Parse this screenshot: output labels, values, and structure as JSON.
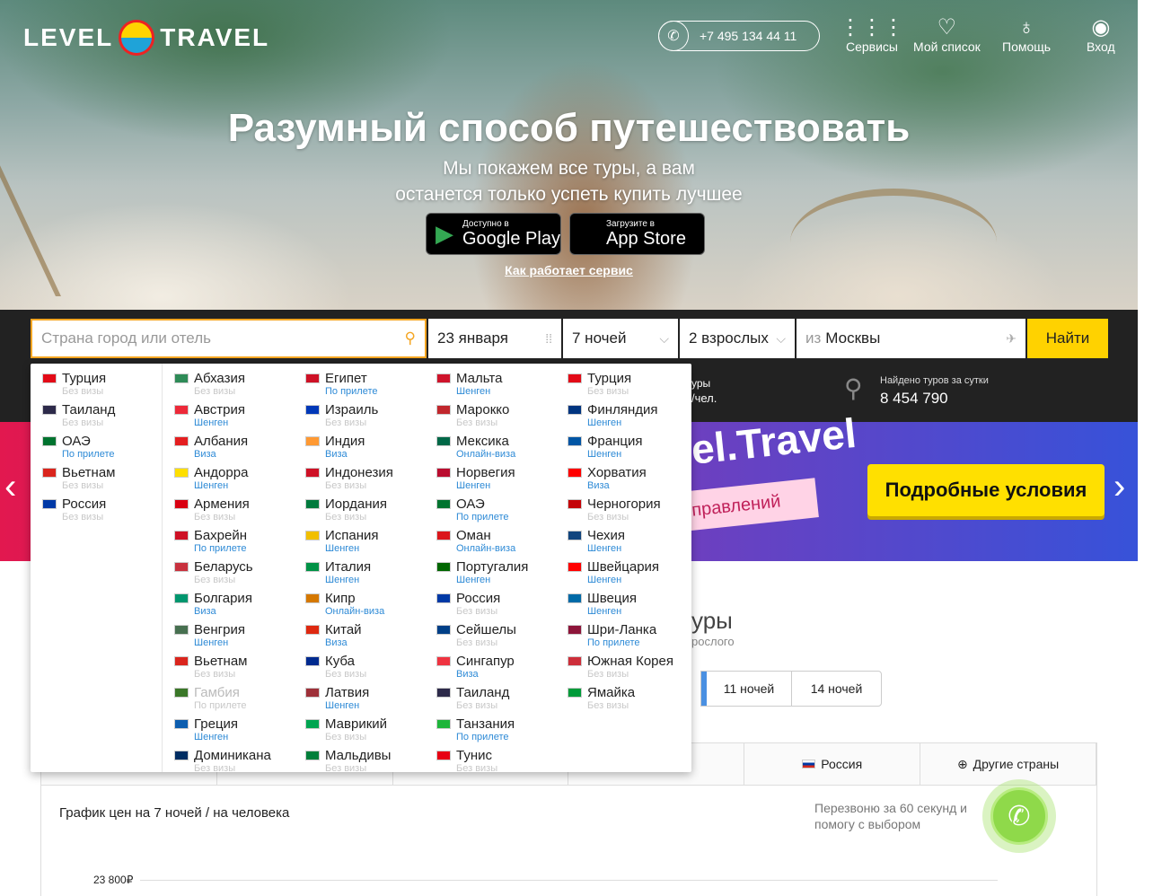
{
  "header": {
    "logo_left": "LEVEL",
    "logo_right": "TRAVEL",
    "phone": "+7 495 134 44 11",
    "nav": [
      {
        "label": "Сервисы",
        "icon": "grid-icon"
      },
      {
        "label": "Мой список",
        "icon": "heart-icon"
      },
      {
        "label": "Помощь",
        "icon": "help-bulb-icon"
      },
      {
        "label": "Вход",
        "icon": "user-icon"
      }
    ]
  },
  "hero": {
    "title": "Разумный способ путешествовать",
    "subtitle_line1": "Мы покажем все туры, а вам",
    "subtitle_line2": "останется только успеть купить лучшее",
    "google_small": "Доступно в",
    "google_big": "Google Play",
    "apple_small": "Загрузите в",
    "apple_big": "App Store",
    "how_link": "Как работает сервис"
  },
  "search": {
    "destination_placeholder": "Страна город или отель",
    "date": "23 января",
    "nights": "7 ночей",
    "tourists": "2 взрослых",
    "from_prefix": "из",
    "from_city": "Москвы",
    "find_button": "Найти"
  },
  "info": {
    "partial1": "уры",
    "partial2": "/чел.",
    "found_label": "Найдено туров за сутки",
    "found_value": "8 454 790"
  },
  "banner": {
    "text": "el.Travel",
    "pink": "правлений",
    "button": "Подробные условия"
  },
  "tours": {
    "title_partial": "уры",
    "sub_partial": "рослого",
    "night_tabs": [
      "11 ночей",
      "14 ночей"
    ],
    "country_tabs": [
      "Россия",
      "Другие страны"
    ]
  },
  "chart_section": {
    "title": "График цен на 7 ночей / на человека",
    "callback_text": "Перезвоню за 60 секунд и помогу с выбором",
    "y_label": "23 800₽"
  },
  "dropdown": {
    "popular": [
      {
        "name": "Турция",
        "visa": "Без визы",
        "flag": "#e30a17"
      },
      {
        "name": "Таиланд",
        "visa": "Без визы",
        "flag": "#2d2a4a"
      },
      {
        "name": "ОАЭ",
        "visa": "По прилете",
        "flag": "#00732f"
      },
      {
        "name": "Вьетнам",
        "visa": "Без визы",
        "flag": "#da251d"
      },
      {
        "name": "Россия",
        "visa": "Без визы",
        "flag": "#0039a6"
      }
    ],
    "columns": [
      [
        {
          "name": "Абхазия",
          "visa": "Без визы",
          "flag": "#2e8b57"
        },
        {
          "name": "Австрия",
          "visa": "Шенген",
          "flag": "#ed2939"
        },
        {
          "name": "Албания",
          "visa": "Виза",
          "flag": "#e41e20"
        },
        {
          "name": "Андорра",
          "visa": "Шенген",
          "flag": "#fedf00"
        },
        {
          "name": "Армения",
          "visa": "Без визы",
          "flag": "#d90012"
        },
        {
          "name": "Бахрейн",
          "visa": "По прилете",
          "flag": "#ce1126"
        },
        {
          "name": "Беларусь",
          "visa": "Без визы",
          "flag": "#c8313e"
        },
        {
          "name": "Болгария",
          "visa": "Виза",
          "flag": "#00966e"
        },
        {
          "name": "Венгрия",
          "visa": "Шенген",
          "flag": "#477050"
        },
        {
          "name": "Вьетнам",
          "visa": "Без визы",
          "flag": "#da251d"
        },
        {
          "name": "Гамбия",
          "visa": "По прилете",
          "flag": "#3a7728",
          "muted": true
        },
        {
          "name": "Греция",
          "visa": "Шенген",
          "flag": "#0d5eaf"
        },
        {
          "name": "Доминикана",
          "visa": "Без визы",
          "flag": "#002d62"
        }
      ],
      [
        {
          "name": "Египет",
          "visa": "По прилете",
          "flag": "#ce1126"
        },
        {
          "name": "Израиль",
          "visa": "Без визы",
          "flag": "#0038b8"
        },
        {
          "name": "Индия",
          "visa": "Виза",
          "flag": "#ff9933"
        },
        {
          "name": "Индонезия",
          "visa": "Без визы",
          "flag": "#ce1126"
        },
        {
          "name": "Иордания",
          "visa": "Без визы",
          "flag": "#007a3d"
        },
        {
          "name": "Испания",
          "visa": "Шенген",
          "flag": "#f1bf00"
        },
        {
          "name": "Италия",
          "visa": "Шенген",
          "flag": "#009246"
        },
        {
          "name": "Кипр",
          "visa": "Онлайн-виза",
          "flag": "#d57800"
        },
        {
          "name": "Китай",
          "visa": "Виза",
          "flag": "#de2910"
        },
        {
          "name": "Куба",
          "visa": "Без визы",
          "flag": "#002a8f"
        },
        {
          "name": "Латвия",
          "visa": "Шенген",
          "flag": "#9e3039"
        },
        {
          "name": "Маврикий",
          "visa": "Без визы",
          "flag": "#00a551"
        },
        {
          "name": "Мальдивы",
          "visa": "Без визы",
          "flag": "#007e3a"
        }
      ],
      [
        {
          "name": "Мальта",
          "visa": "Шенген",
          "flag": "#cf142b"
        },
        {
          "name": "Марокко",
          "visa": "Без визы",
          "flag": "#c1272d"
        },
        {
          "name": "Мексика",
          "visa": "Онлайн-виза",
          "flag": "#006847"
        },
        {
          "name": "Норвегия",
          "visa": "Шенген",
          "flag": "#ba0c2f"
        },
        {
          "name": "ОАЭ",
          "visa": "По прилете",
          "flag": "#00732f"
        },
        {
          "name": "Оман",
          "visa": "Онлайн-виза",
          "flag": "#db161b"
        },
        {
          "name": "Португалия",
          "visa": "Шенген",
          "flag": "#006600"
        },
        {
          "name": "Россия",
          "visa": "Без визы",
          "flag": "#0039a6"
        },
        {
          "name": "Сейшелы",
          "visa": "Без визы",
          "flag": "#003f87"
        },
        {
          "name": "Сингапур",
          "visa": "Виза",
          "flag": "#ef3340"
        },
        {
          "name": "Таиланд",
          "visa": "Без визы",
          "flag": "#2d2a4a"
        },
        {
          "name": "Танзания",
          "visa": "По прилете",
          "flag": "#1eb53a"
        },
        {
          "name": "Тунис",
          "visa": "Без визы",
          "flag": "#e70013"
        }
      ],
      [
        {
          "name": "Турция",
          "visa": "Без визы",
          "flag": "#e30a17"
        },
        {
          "name": "Финляндия",
          "visa": "Шенген",
          "flag": "#003580"
        },
        {
          "name": "Франция",
          "visa": "Шенген",
          "flag": "#0055a4"
        },
        {
          "name": "Хорватия",
          "visa": "Виза",
          "flag": "#ff0000"
        },
        {
          "name": "Черногория",
          "visa": "Без визы",
          "flag": "#c40308"
        },
        {
          "name": "Чехия",
          "visa": "Шенген",
          "flag": "#11457e"
        },
        {
          "name": "Швейцария",
          "visa": "Шенген",
          "flag": "#ff0000"
        },
        {
          "name": "Швеция",
          "visa": "Шенген",
          "flag": "#006aa7"
        },
        {
          "name": "Шри-Ланка",
          "visa": "По прилете",
          "flag": "#8d153a"
        },
        {
          "name": "Южная Корея",
          "visa": "Без визы",
          "flag": "#cd2e3a"
        },
        {
          "name": "Ямайка",
          "visa": "Без визы",
          "flag": "#009b3a"
        }
      ]
    ]
  }
}
